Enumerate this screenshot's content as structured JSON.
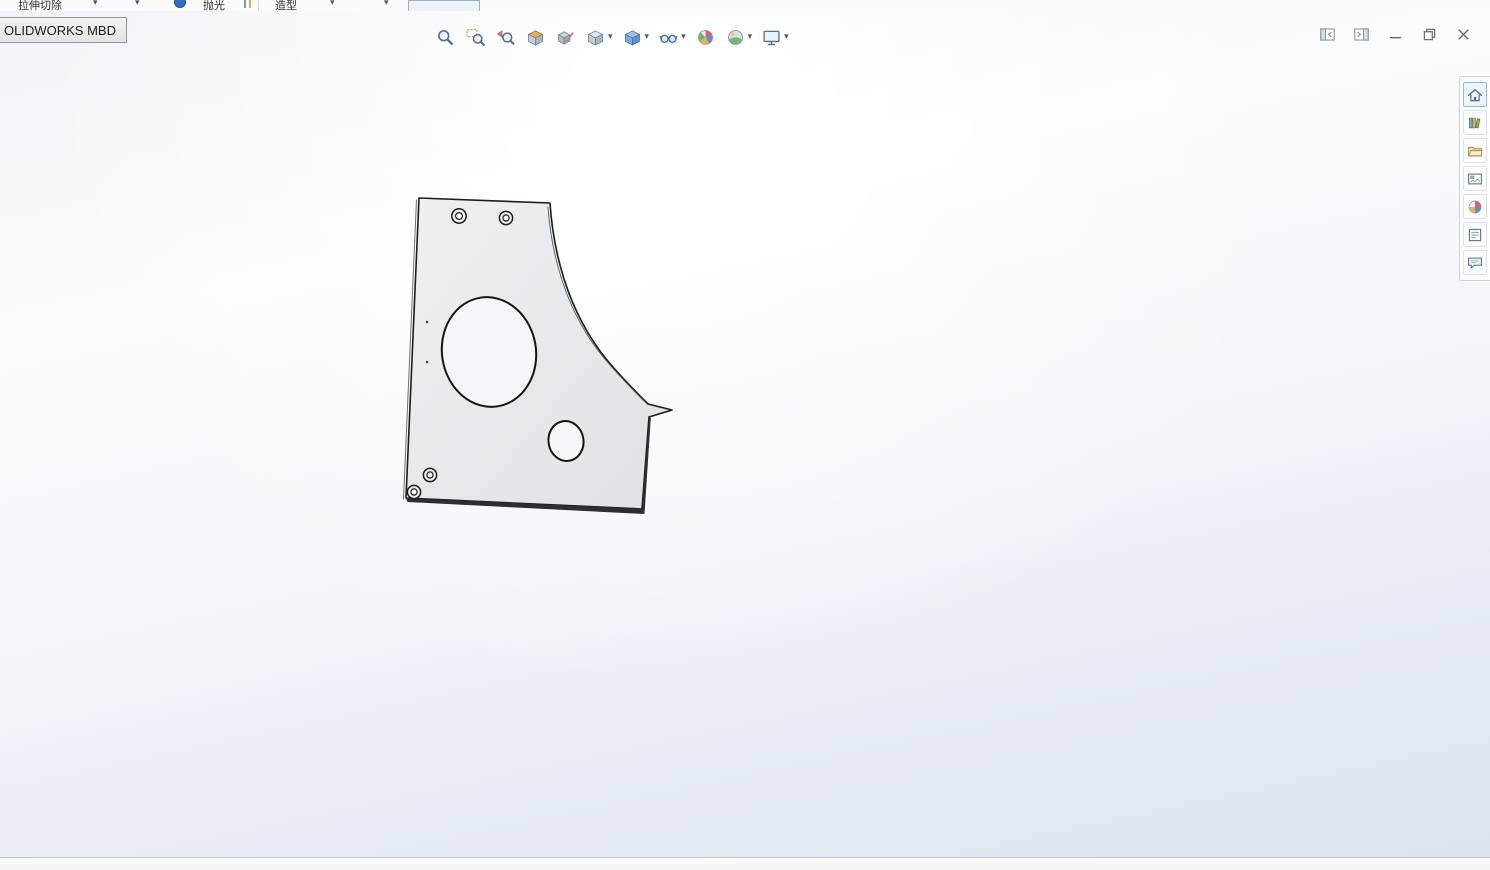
{
  "command_manager": {
    "items": [
      {
        "label": "拉伸切除"
      },
      {
        "label": "抛光"
      },
      {
        "label": "造型"
      }
    ],
    "tab_label": "OLIDWORKS MBD"
  },
  "heads_up": {
    "items": [
      {
        "icon": "zoom-to-fit-icon",
        "dropdown": false
      },
      {
        "icon": "zoom-to-area-icon",
        "dropdown": false
      },
      {
        "icon": "previous-view-icon",
        "dropdown": false
      },
      {
        "icon": "section-view-icon",
        "dropdown": false
      },
      {
        "icon": "dynamic-annotation-views-icon",
        "dropdown": false
      },
      {
        "icon": "view-orientation-icon",
        "dropdown": true
      },
      {
        "icon": "display-style-icon",
        "dropdown": true
      },
      {
        "icon": "hide-show-items-icon",
        "dropdown": true
      },
      {
        "icon": "edit-appearance-icon",
        "dropdown": false
      },
      {
        "icon": "apply-scene-icon",
        "dropdown": true
      },
      {
        "icon": "view-settings-icon",
        "dropdown": true
      }
    ]
  },
  "window_controls": {
    "items": [
      {
        "icon": "pane-preview-left-icon"
      },
      {
        "icon": "pane-preview-right-icon"
      },
      {
        "icon": "minimize-icon"
      },
      {
        "icon": "restore-icon"
      },
      {
        "icon": "close-icon"
      }
    ]
  },
  "task_pane": {
    "items": [
      {
        "icon": "home-icon",
        "active": true
      },
      {
        "icon": "design-library-icon"
      },
      {
        "icon": "file-explorer-icon"
      },
      {
        "icon": "view-palette-icon"
      },
      {
        "icon": "appearances-icon"
      },
      {
        "icon": "custom-properties-icon"
      },
      {
        "icon": "forum-icon"
      }
    ]
  },
  "colors": {
    "part_face": "#e9ebed",
    "part_edge": "#1c1c1c",
    "viewport_bottom": "#dde4ee",
    "tab_background": "#e9e9e9"
  }
}
